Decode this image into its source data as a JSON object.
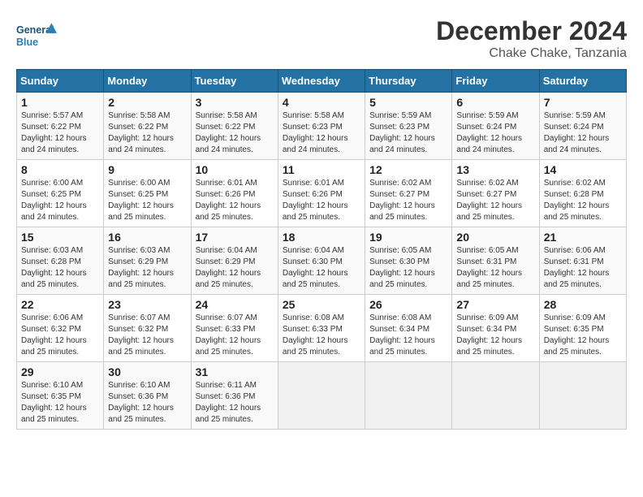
{
  "logo": {
    "line1": "General",
    "line2": "Blue"
  },
  "title": "December 2024",
  "subtitle": "Chake Chake, Tanzania",
  "headers": [
    "Sunday",
    "Monday",
    "Tuesday",
    "Wednesday",
    "Thursday",
    "Friday",
    "Saturday"
  ],
  "weeks": [
    [
      {
        "day": "1",
        "info": "Sunrise: 5:57 AM\nSunset: 6:22 PM\nDaylight: 12 hours\nand 24 minutes."
      },
      {
        "day": "2",
        "info": "Sunrise: 5:58 AM\nSunset: 6:22 PM\nDaylight: 12 hours\nand 24 minutes."
      },
      {
        "day": "3",
        "info": "Sunrise: 5:58 AM\nSunset: 6:22 PM\nDaylight: 12 hours\nand 24 minutes."
      },
      {
        "day": "4",
        "info": "Sunrise: 5:58 AM\nSunset: 6:23 PM\nDaylight: 12 hours\nand 24 minutes."
      },
      {
        "day": "5",
        "info": "Sunrise: 5:59 AM\nSunset: 6:23 PM\nDaylight: 12 hours\nand 24 minutes."
      },
      {
        "day": "6",
        "info": "Sunrise: 5:59 AM\nSunset: 6:24 PM\nDaylight: 12 hours\nand 24 minutes."
      },
      {
        "day": "7",
        "info": "Sunrise: 5:59 AM\nSunset: 6:24 PM\nDaylight: 12 hours\nand 24 minutes."
      }
    ],
    [
      {
        "day": "8",
        "info": "Sunrise: 6:00 AM\nSunset: 6:25 PM\nDaylight: 12 hours\nand 24 minutes."
      },
      {
        "day": "9",
        "info": "Sunrise: 6:00 AM\nSunset: 6:25 PM\nDaylight: 12 hours\nand 25 minutes."
      },
      {
        "day": "10",
        "info": "Sunrise: 6:01 AM\nSunset: 6:26 PM\nDaylight: 12 hours\nand 25 minutes."
      },
      {
        "day": "11",
        "info": "Sunrise: 6:01 AM\nSunset: 6:26 PM\nDaylight: 12 hours\nand 25 minutes."
      },
      {
        "day": "12",
        "info": "Sunrise: 6:02 AM\nSunset: 6:27 PM\nDaylight: 12 hours\nand 25 minutes."
      },
      {
        "day": "13",
        "info": "Sunrise: 6:02 AM\nSunset: 6:27 PM\nDaylight: 12 hours\nand 25 minutes."
      },
      {
        "day": "14",
        "info": "Sunrise: 6:02 AM\nSunset: 6:28 PM\nDaylight: 12 hours\nand 25 minutes."
      }
    ],
    [
      {
        "day": "15",
        "info": "Sunrise: 6:03 AM\nSunset: 6:28 PM\nDaylight: 12 hours\nand 25 minutes."
      },
      {
        "day": "16",
        "info": "Sunrise: 6:03 AM\nSunset: 6:29 PM\nDaylight: 12 hours\nand 25 minutes."
      },
      {
        "day": "17",
        "info": "Sunrise: 6:04 AM\nSunset: 6:29 PM\nDaylight: 12 hours\nand 25 minutes."
      },
      {
        "day": "18",
        "info": "Sunrise: 6:04 AM\nSunset: 6:30 PM\nDaylight: 12 hours\nand 25 minutes."
      },
      {
        "day": "19",
        "info": "Sunrise: 6:05 AM\nSunset: 6:30 PM\nDaylight: 12 hours\nand 25 minutes."
      },
      {
        "day": "20",
        "info": "Sunrise: 6:05 AM\nSunset: 6:31 PM\nDaylight: 12 hours\nand 25 minutes."
      },
      {
        "day": "21",
        "info": "Sunrise: 6:06 AM\nSunset: 6:31 PM\nDaylight: 12 hours\nand 25 minutes."
      }
    ],
    [
      {
        "day": "22",
        "info": "Sunrise: 6:06 AM\nSunset: 6:32 PM\nDaylight: 12 hours\nand 25 minutes."
      },
      {
        "day": "23",
        "info": "Sunrise: 6:07 AM\nSunset: 6:32 PM\nDaylight: 12 hours\nand 25 minutes."
      },
      {
        "day": "24",
        "info": "Sunrise: 6:07 AM\nSunset: 6:33 PM\nDaylight: 12 hours\nand 25 minutes."
      },
      {
        "day": "25",
        "info": "Sunrise: 6:08 AM\nSunset: 6:33 PM\nDaylight: 12 hours\nand 25 minutes."
      },
      {
        "day": "26",
        "info": "Sunrise: 6:08 AM\nSunset: 6:34 PM\nDaylight: 12 hours\nand 25 minutes."
      },
      {
        "day": "27",
        "info": "Sunrise: 6:09 AM\nSunset: 6:34 PM\nDaylight: 12 hours\nand 25 minutes."
      },
      {
        "day": "28",
        "info": "Sunrise: 6:09 AM\nSunset: 6:35 PM\nDaylight: 12 hours\nand 25 minutes."
      }
    ],
    [
      {
        "day": "29",
        "info": "Sunrise: 6:10 AM\nSunset: 6:35 PM\nDaylight: 12 hours\nand 25 minutes."
      },
      {
        "day": "30",
        "info": "Sunrise: 6:10 AM\nSunset: 6:36 PM\nDaylight: 12 hours\nand 25 minutes."
      },
      {
        "day": "31",
        "info": "Sunrise: 6:11 AM\nSunset: 6:36 PM\nDaylight: 12 hours\nand 25 minutes."
      },
      {
        "day": "",
        "info": ""
      },
      {
        "day": "",
        "info": ""
      },
      {
        "day": "",
        "info": ""
      },
      {
        "day": "",
        "info": ""
      }
    ]
  ]
}
